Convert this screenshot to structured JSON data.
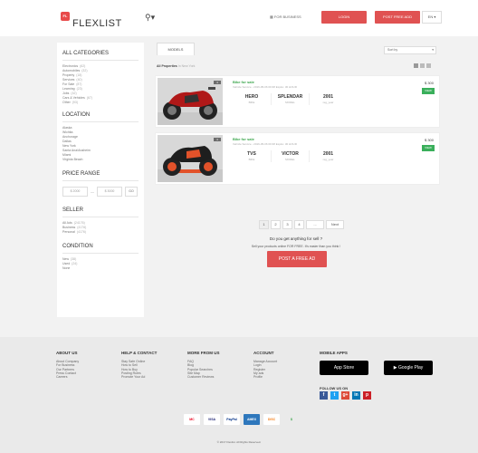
{
  "header": {
    "logo_badge": "FL",
    "logo_text": "FLEXLIST",
    "location_icon": "map-pin-icon",
    "business_link": "FOR BUSINESS",
    "login_label": "LOGIN",
    "post_ad_label": "POST FREE ADD",
    "language": "EN"
  },
  "sidebar": {
    "categories_title": "ALL CATEGORIES",
    "categories": [
      {
        "label": "Electronics",
        "count": "(62)"
      },
      {
        "label": "Automobiles",
        "count": "(32)"
      },
      {
        "label": "Property",
        "count": "(18)"
      },
      {
        "label": "Services",
        "count": "(40)"
      },
      {
        "label": "For Sale",
        "count": "(87)"
      },
      {
        "label": "Learning",
        "count": "(23)"
      },
      {
        "label": "Jobs",
        "count": "(42)"
      },
      {
        "label": "Cars & Vehicles",
        "count": "(67)"
      },
      {
        "label": "Other",
        "count": "(93)"
      }
    ],
    "location_title": "LOCATION",
    "locations": [
      "Alaska",
      "Wichita",
      "Anchorage",
      "Dallas",
      "New York",
      "Santa Ana/Anaheim",
      "Miami",
      "Virginia Beach"
    ],
    "price_title": "PRICE RANGE",
    "price_min": "$ 2000",
    "price_max": "$ 3000",
    "go_label": "GO",
    "seller_title": "SELLER",
    "sellers": [
      {
        "label": "All Ads",
        "count": "(24176)"
      },
      {
        "label": "Business",
        "count": "(4176)"
      },
      {
        "label": "Personal",
        "count": "(4176)"
      }
    ],
    "condition_title": "CONDITION",
    "conditions": [
      {
        "label": "New",
        "count": "(38)"
      },
      {
        "label": "Used",
        "count": "(24)"
      },
      {
        "label": "None",
        "count": ""
      }
    ]
  },
  "main": {
    "tab_label": "MODELS",
    "sort_label": "Sort by",
    "results_label": "All Properties",
    "results_note": "In New York",
    "listings": [
      {
        "photo_count": "4",
        "title": "Bike for sale",
        "meta": "Vehicle Service - 2016-05-06 09:38 Expire: 30 HOUR",
        "brand": "HERO",
        "brand_key": "BIKE",
        "model": "SPLENDAR",
        "model_key": "MODEL",
        "year": "2001",
        "year_key": "reg_year",
        "price": "$ 300",
        "view_label": "VIEW",
        "colors": {
          "body": "#b01818",
          "accent": "#333333"
        }
      },
      {
        "photo_count": "4",
        "title": "Bike for sale",
        "meta": "Vehicle Service - 2016-05-06 09:38 Expire: 30 HOUR",
        "brand": "TVS",
        "brand_key": "BIKE",
        "model": "VICTOR",
        "model_key": "MODEL",
        "year": "2001",
        "year_key": "reg_year",
        "price": "$ 300",
        "view_label": "VIEW",
        "colors": {
          "body": "#1e1e1e",
          "accent": "#e2522a"
        }
      }
    ],
    "pagination": [
      "1",
      "2",
      "3",
      "4",
      "...",
      "Next"
    ],
    "cta_title": "Do you get anything for sell ?",
    "cta_subtitle": "Sell your products online FOR FREE. It's easier than you think !",
    "cta_button": "POST A FREE AD"
  },
  "footer": {
    "about_title": "ABOUT US",
    "about": [
      "About Company",
      "For Business",
      "Our Partners",
      "Press Contact",
      "Careers"
    ],
    "help_title": "HELP & CONTACT",
    "help": [
      "Stay Safe Online",
      "How to Sell",
      "How to Buy",
      "Posting Rules",
      "Promote Your Ad"
    ],
    "more_title": "MORE FROM US",
    "more": [
      "FAQ",
      "Blog",
      "Popular Searches",
      "Site Map",
      "Customer Reviews"
    ],
    "account_title": "ACCOUNT",
    "account": [
      "Manage Account",
      "Login",
      "Register",
      "My ads",
      "Profile"
    ],
    "mobile_title": "MOBILE APPS",
    "app_store": "App Store",
    "google_play": "Google Play",
    "follow_label": "FOLLOW US ON",
    "socials": [
      "f",
      "t",
      "g+",
      "in",
      "p"
    ],
    "payments": [
      "MC",
      "VISA",
      "PayPal",
      "AMEX",
      "DISC",
      "$"
    ],
    "copyright": "© 2017 Flexlist. All Rights Reserved."
  },
  "colors": {
    "brand_red": "#e05252",
    "green": "#3aa54b",
    "page_bg": "#f2f2f2"
  }
}
